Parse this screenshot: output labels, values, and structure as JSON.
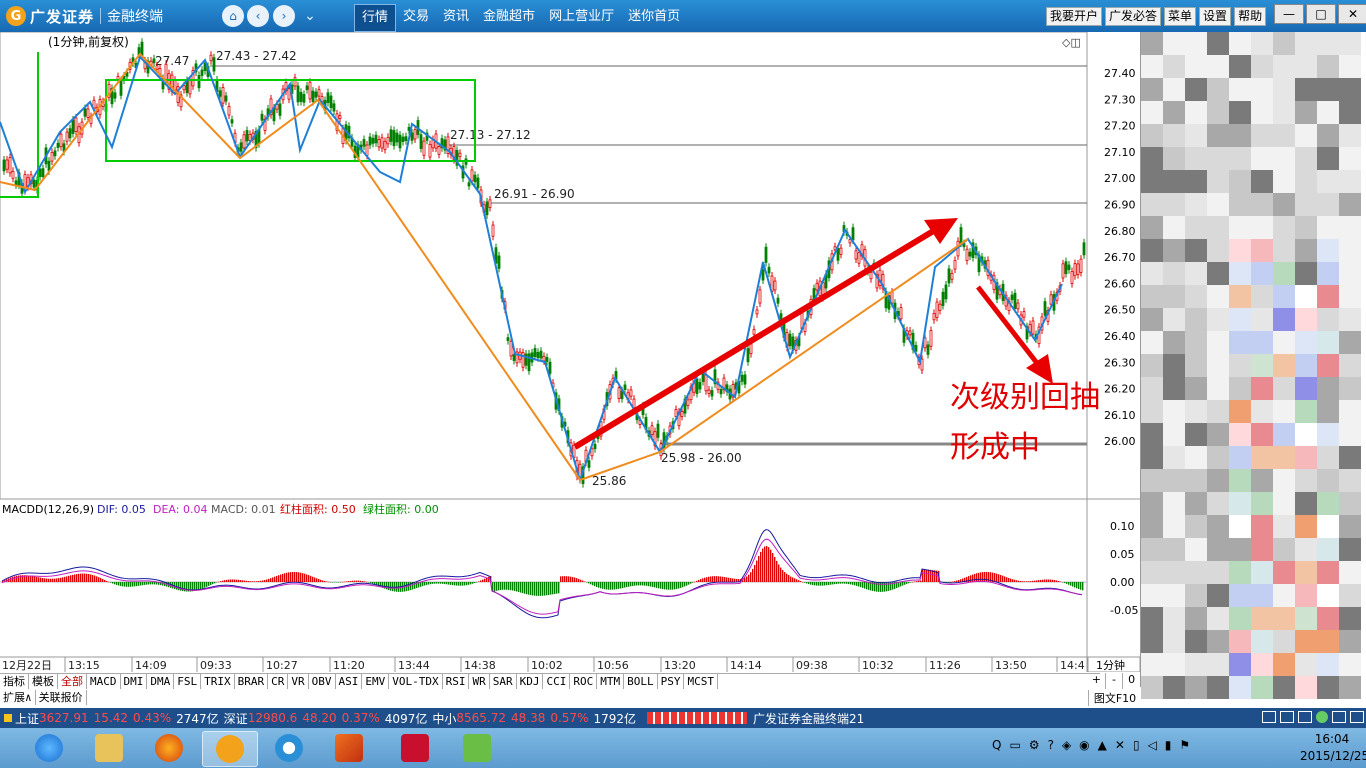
{
  "app": {
    "brand": "广发证券",
    "title": "金融终端",
    "menu": [
      "行情",
      "交易",
      "资讯",
      "金融超市",
      "网上营业厅",
      "迷你首页"
    ],
    "active_menu": "行情",
    "right_buttons": [
      "我要开户",
      "广发必答",
      "菜单",
      "设置",
      "帮助"
    ],
    "window_controls": [
      "—",
      "□",
      "✕"
    ]
  },
  "chart": {
    "header": "(1分钟,前复权)",
    "price_ticks": [
      "27.40",
      "27.30",
      "27.20",
      "27.10",
      "27.00",
      "26.90",
      "26.80",
      "26.70",
      "26.60",
      "26.50",
      "26.40",
      "26.30",
      "26.20",
      "26.10",
      "26.00"
    ],
    "level_labels": [
      "27.47",
      "27.43 - 27.42",
      "27.13 - 27.12",
      "26.91 - 26.90",
      "25.98 - 26.00",
      "25.86"
    ],
    "annotation_line1": "次级别回抽",
    "annotation_line2": "形成中",
    "macd_header": {
      "name": "MACDD(12,26,9)",
      "dif": "DIF: 0.05",
      "dea": "DEA: 0.04",
      "macd": "MACD: 0.01",
      "red_area": "红柱面积: 0.50",
      "green_area": "绿柱面积: 0.00"
    },
    "macd_ticks": [
      "0.10",
      "0.05",
      "0.00",
      "-0.05"
    ],
    "time_axis": [
      "12月22日",
      "13:15",
      "14:09",
      "09:33",
      "10:27",
      "11:20",
      "13:44",
      "14:38",
      "10:02",
      "10:56",
      "13:20",
      "14:14",
      "09:38",
      "10:32",
      "11:26",
      "13:50",
      "14:4"
    ],
    "period": "1分钟",
    "colors": {
      "up": "#e00000",
      "down": "#008000",
      "wave": "#1f7fd6",
      "trend": "#f08c1e",
      "box": "#00cc00",
      "arrow": "#e80000",
      "dif": "#1a1aa0",
      "dea": "#c020c0"
    }
  },
  "toolbar": {
    "tabs": [
      "指标",
      "模板",
      "全部",
      "MACD",
      "DMI",
      "DMA",
      "FSL",
      "TRIX",
      "BRAR",
      "CR",
      "VR",
      "OBV",
      "ASI",
      "EMV",
      "VOL-TDX",
      "RSI",
      "WR",
      "SAR",
      "KDJ",
      "CCI",
      "ROC",
      "MTM",
      "BOLL",
      "PSY",
      "MCST"
    ],
    "selected_tab": "全部",
    "sub_tabs": [
      "扩展∧",
      "关联报价"
    ],
    "right_controls": [
      "+",
      "-",
      "0"
    ],
    "right_label": "图文F10"
  },
  "status_bar": {
    "sh_label": "上证",
    "sh_value": "3627.91",
    "sh_change": "15.42",
    "sh_pct": "0.43%",
    "sh_amount": "2747亿",
    "sz_label": "深证",
    "sz_value": "12980.6",
    "sz_change": "48.20",
    "sz_pct": "0.37%",
    "sz_amount": "4097亿",
    "zx_label": "中小",
    "zx_value": "8565.72",
    "zx_change": "48.38",
    "zx_pct": "0.57%",
    "zx_amount": "1792亿",
    "app_name": "广发证券金融终端21"
  },
  "taskbar": {
    "time": "16:04",
    "date": "2015/12/25"
  }
}
